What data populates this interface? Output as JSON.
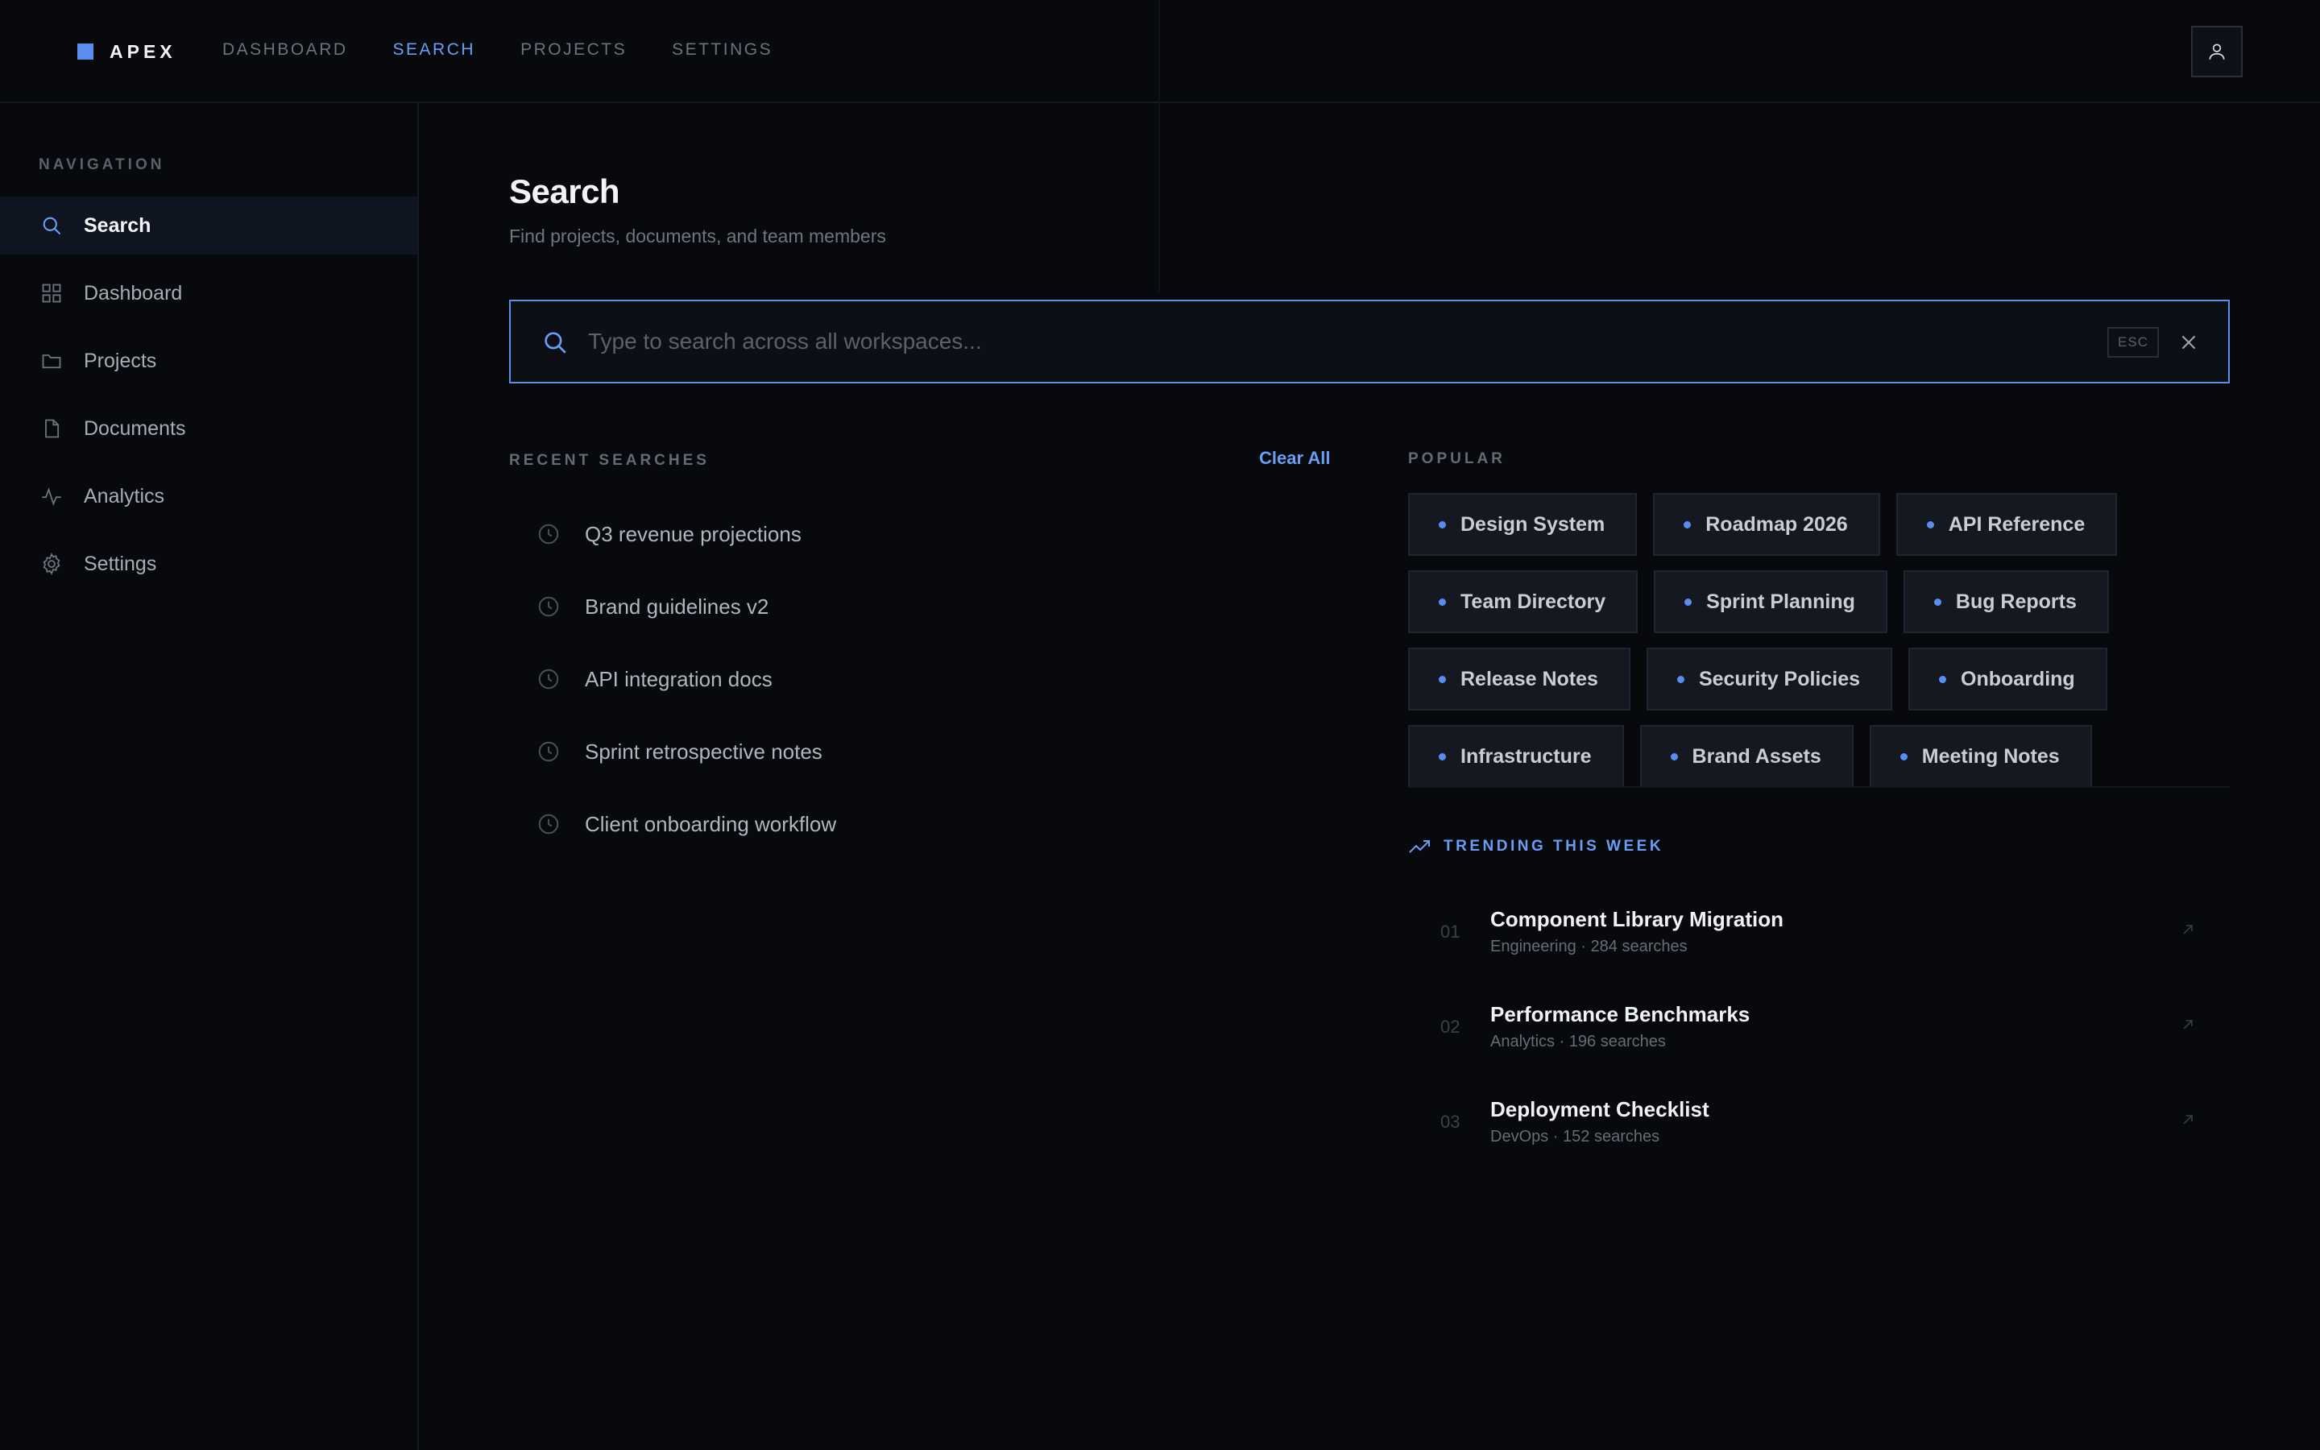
{
  "app": {
    "brand": "APEX",
    "accent": "#5b8def"
  },
  "topnav": [
    {
      "label": "DASHBOARD",
      "active": false
    },
    {
      "label": "SEARCH",
      "active": true
    },
    {
      "label": "PROJECTS",
      "active": false
    },
    {
      "label": "SETTINGS",
      "active": false
    }
  ],
  "user": {
    "icon": "user-icon"
  },
  "sidebar": {
    "heading": "NAVIGATION",
    "items": [
      {
        "label": "Search",
        "icon": "search-icon",
        "active": true
      },
      {
        "label": "Dashboard",
        "icon": "grid-icon",
        "active": false
      },
      {
        "label": "Projects",
        "icon": "folder-icon",
        "active": false
      },
      {
        "label": "Documents",
        "icon": "document-icon",
        "active": false
      },
      {
        "label": "Analytics",
        "icon": "activity-icon",
        "active": false
      },
      {
        "label": "Settings",
        "icon": "gear-icon",
        "active": false
      }
    ]
  },
  "page": {
    "title": "Search",
    "subtitle": "Find projects, documents, and team members"
  },
  "search": {
    "placeholder": "Type to search across all workspaces...",
    "value": "",
    "esc_label": "ESC"
  },
  "recent": {
    "heading": "RECENT SEARCHES",
    "clear_label": "Clear All",
    "items": [
      "Q3 revenue projections",
      "Brand guidelines v2",
      "API integration docs",
      "Sprint retrospective notes",
      "Client onboarding workflow"
    ]
  },
  "popular": {
    "heading": "POPULAR",
    "rows": [
      [
        "Design System",
        "Roadmap 2026",
        "API Reference"
      ],
      [
        "Team Directory",
        "Sprint Planning",
        "Bug Reports"
      ],
      [
        "Release Notes",
        "Security Policies",
        "Onboarding"
      ],
      [
        "Infrastructure",
        "Brand Assets",
        "Meeting Notes"
      ]
    ]
  },
  "trending": {
    "heading": "TRENDING THIS WEEK",
    "items": [
      {
        "num": "01",
        "title": "Component Library Migration",
        "meta": "Engineering · 284 searches"
      },
      {
        "num": "02",
        "title": "Performance Benchmarks",
        "meta": "Analytics · 196 searches"
      },
      {
        "num": "03",
        "title": "Deployment Checklist",
        "meta": "DevOps · 152 searches"
      }
    ]
  }
}
